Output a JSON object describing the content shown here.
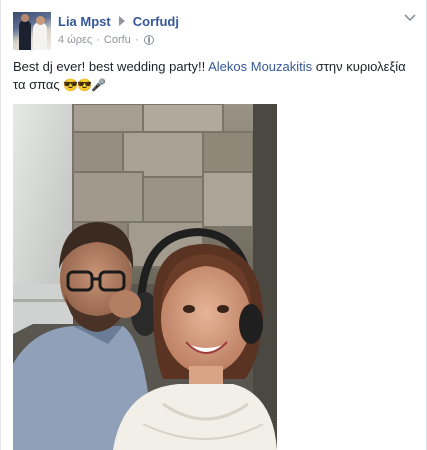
{
  "post": {
    "author": "Lia Mpst",
    "target": "Corfudj",
    "time": "4 ώρες",
    "separator": "·",
    "location": "Corfu",
    "text_before": "Best dj ever! best wedding party!! ",
    "tagged_name": "Alekos Mouzakitis",
    "text_after": " στην κυριολεξία τα σπας ",
    "emoji": "😎😎🎤"
  },
  "icons": {
    "arrow": "right-triangle-icon",
    "privacy": "globe-icon",
    "menu": "chevron-down-icon"
  },
  "colors": {
    "link": "#365899",
    "meta": "#90949c",
    "text": "#1d2129"
  }
}
